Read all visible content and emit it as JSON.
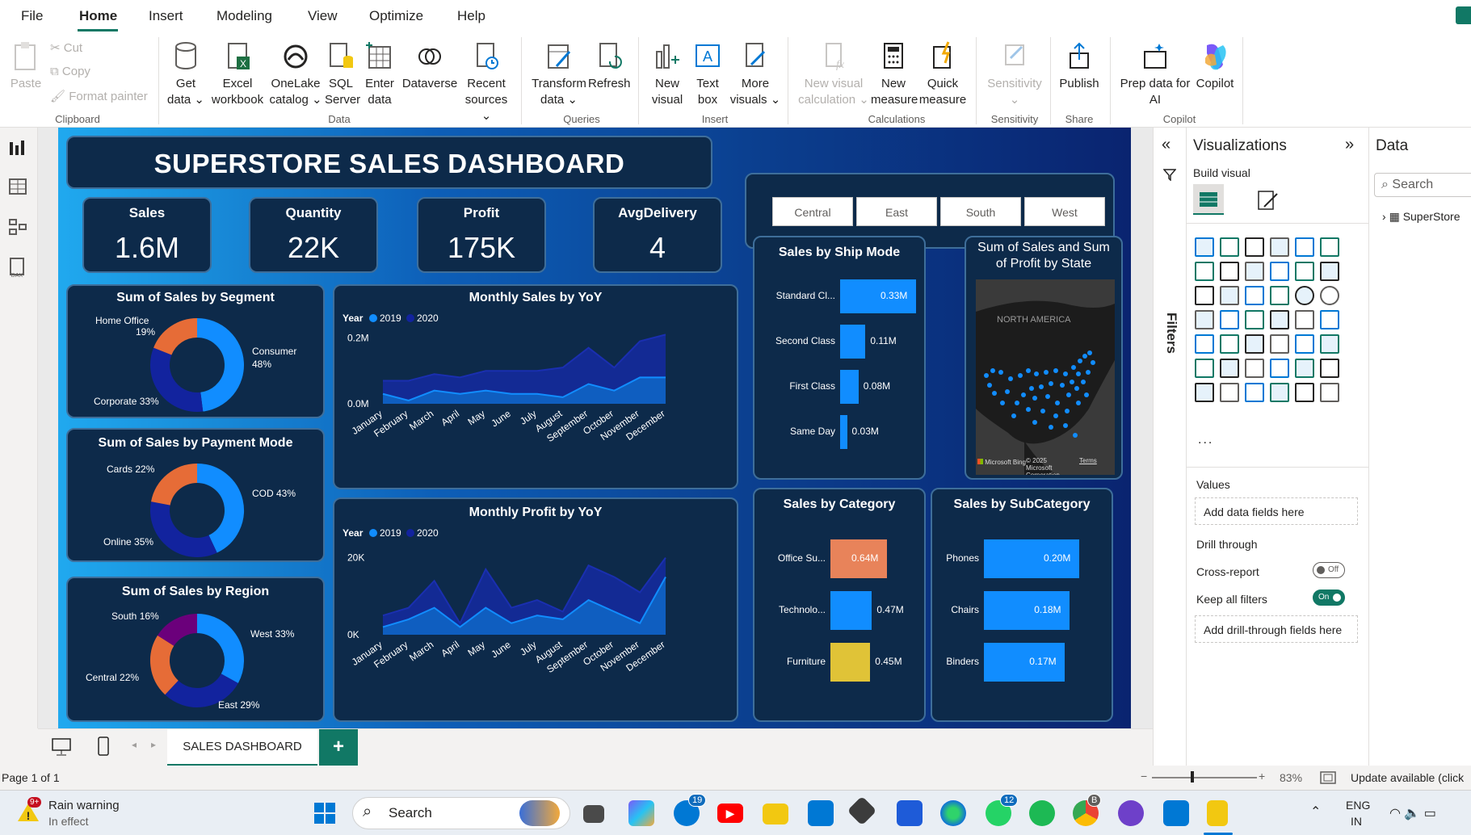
{
  "menu": {
    "file": "File",
    "home": "Home",
    "insert": "Insert",
    "modeling": "Modeling",
    "view": "View",
    "optimize": "Optimize",
    "help": "Help"
  },
  "ribbon": {
    "paste": "Paste",
    "cut": "Cut",
    "copy": "Copy",
    "format_painter": "Format painter",
    "clipboard": "Clipboard",
    "get_data_1": "Get",
    "get_data_2": "data",
    "excel_1": "Excel",
    "excel_2": "workbook",
    "onelake_1": "OneLake",
    "onelake_2": "catalog",
    "sql_1": "SQL",
    "sql_2": "Server",
    "enter_1": "Enter",
    "enter_2": "data",
    "dataverse": "Dataverse",
    "recent_1": "Recent",
    "recent_2": "sources",
    "data_group": "Data",
    "transform_1": "Transform",
    "transform_2": "data",
    "refresh": "Refresh",
    "queries": "Queries",
    "new_visual_1": "New",
    "new_visual_2": "visual",
    "text_box_1": "Text",
    "text_box_2": "box",
    "more_visuals_1": "More",
    "more_visuals_2": "visuals",
    "insert_group": "Insert",
    "new_visual_calc_1": "New visual",
    "new_visual_calc_2": "calculation",
    "new_measure_1": "New",
    "new_measure_2": "measure",
    "quick_measure_1": "Quick",
    "quick_measure_2": "measure",
    "calculations": "Calculations",
    "sensitivity": "Sensitivity",
    "sensitivity_group": "Sensitivity",
    "publish": "Publish",
    "share": "Share",
    "prep_1": "Prep data for",
    "prep_2": "AI",
    "copilot": "Copilot",
    "copilot_group": "Copilot"
  },
  "dashboard": {
    "title": "SUPERSTORE SALES DASHBOARD",
    "kpis": [
      {
        "label": "Sales",
        "value": "1.6M"
      },
      {
        "label": "Quantity",
        "value": "22K"
      },
      {
        "label": "Profit",
        "value": "175K"
      },
      {
        "label": "AvgDelivery",
        "value": "4"
      }
    ],
    "slicer": [
      "Central",
      "East",
      "South",
      "West"
    ],
    "segment": {
      "title": "Sum of Sales by Segment",
      "labels": [
        "Home Office",
        "19%",
        "Consumer",
        "48%",
        "Corporate 33%"
      ]
    },
    "payment": {
      "title": "Sum of Sales by Payment Mode",
      "labels": [
        "Cards 22%",
        "COD 43%",
        "Online 35%"
      ]
    },
    "region": {
      "title": "Sum of Sales by Region",
      "labels": [
        "South 16%",
        "West 33%",
        "Central 22%",
        "East 29%"
      ]
    },
    "monthly_sales": {
      "title": "Monthly Sales by YoY",
      "legend_title": "Year",
      "legend": [
        "2019",
        "2020"
      ],
      "yticks": [
        "0.2M",
        "0.0M"
      ]
    },
    "monthly_profit": {
      "title": "Monthly Profit by YoY",
      "legend_title": "Year",
      "legend": [
        "2019",
        "2020"
      ],
      "yticks": [
        "20K",
        "0K"
      ]
    },
    "months": [
      "January",
      "February",
      "March",
      "April",
      "May",
      "June",
      "July",
      "August",
      "September",
      "October",
      "November",
      "December"
    ],
    "ship_mode": {
      "title": "Sales by Ship Mode",
      "rows": [
        {
          "label": "Standard Cl...",
          "value": "0.33M"
        },
        {
          "label": "Second Class",
          "value": "0.11M"
        },
        {
          "label": "First Class",
          "value": "0.08M"
        },
        {
          "label": "Same Day",
          "value": "0.03M"
        }
      ]
    },
    "state_map": {
      "title_1": "Sum of Sales and Sum",
      "title_2": "of Profit by State",
      "region": "NORTH AMERICA",
      "credit": "© 2025 Microsoft Corporation",
      "terms": "Terms",
      "ms": "Microsoft Bing"
    },
    "category": {
      "title": "Sales by Category",
      "rows": [
        {
          "label": "Office Su...",
          "value": "0.64M"
        },
        {
          "label": "Technolo...",
          "value": "0.47M"
        },
        {
          "label": "Furniture",
          "value": "0.45M"
        }
      ]
    },
    "subcategory": {
      "title": "Sales by SubCategory",
      "rows": [
        {
          "label": "Phones",
          "value": "0.20M"
        },
        {
          "label": "Chairs",
          "value": "0.18M"
        },
        {
          "label": "Binders",
          "value": "0.17M"
        }
      ]
    }
  },
  "chart_data": [
    {
      "type": "pie",
      "title": "Sum of Sales by Segment",
      "categories": [
        "Consumer",
        "Corporate",
        "Home Office"
      ],
      "values": [
        48,
        33,
        19
      ]
    },
    {
      "type": "pie",
      "title": "Sum of Sales by Payment Mode",
      "categories": [
        "COD",
        "Online",
        "Cards"
      ],
      "values": [
        43,
        35,
        22
      ]
    },
    {
      "type": "pie",
      "title": "Sum of Sales by Region",
      "categories": [
        "West",
        "East",
        "Central",
        "South"
      ],
      "values": [
        33,
        29,
        22,
        16
      ]
    },
    {
      "type": "area",
      "title": "Monthly Sales by YoY",
      "categories": [
        "January",
        "February",
        "March",
        "April",
        "May",
        "June",
        "July",
        "August",
        "September",
        "October",
        "November",
        "December"
      ],
      "series": [
        {
          "name": "2019",
          "values": [
            0.03,
            0.01,
            0.04,
            0.03,
            0.04,
            0.03,
            0.03,
            0.02,
            0.06,
            0.04,
            0.08,
            0.08
          ]
        },
        {
          "name": "2020",
          "values": [
            0.07,
            0.07,
            0.09,
            0.08,
            0.1,
            0.1,
            0.1,
            0.11,
            0.17,
            0.11,
            0.19,
            0.21
          ]
        }
      ],
      "ylim": [
        0,
        0.26
      ]
    },
    {
      "type": "area",
      "title": "Monthly Profit by YoY",
      "categories": [
        "January",
        "February",
        "March",
        "April",
        "May",
        "June",
        "July",
        "August",
        "September",
        "October",
        "November",
        "December"
      ],
      "series": [
        {
          "name": "2019",
          "values": [
            2,
            4,
            7,
            2,
            7,
            3,
            5,
            4,
            9,
            6,
            3,
            15
          ]
        },
        {
          "name": "2020",
          "values": [
            5,
            7,
            14,
            3,
            17,
            7,
            9,
            6,
            18,
            15,
            11,
            20
          ]
        }
      ],
      "ylim": [
        0,
        26
      ]
    },
    {
      "type": "bar",
      "title": "Sales by Ship Mode",
      "categories": [
        "Standard Cl...",
        "Second Class",
        "First Class",
        "Same Day"
      ],
      "values": [
        0.33,
        0.11,
        0.08,
        0.03
      ]
    },
    {
      "type": "bar",
      "title": "Sales by Category",
      "categories": [
        "Office Su...",
        "Technolo...",
        "Furniture"
      ],
      "values": [
        0.64,
        0.47,
        0.45
      ]
    },
    {
      "type": "bar",
      "title": "Sales by SubCategory",
      "categories": [
        "Phones",
        "Chairs",
        "Binders"
      ],
      "values": [
        0.2,
        0.18,
        0.17
      ]
    }
  ],
  "colors": {
    "accent": "#117865",
    "consumer": "#118dff",
    "corporate": "#12239e",
    "home_office": "#e66c37",
    "south": "#6b007b",
    "bar": "#118dff",
    "office": "#e8835a",
    "furniture": "#e0c337"
  },
  "left_nav": [
    "report-view-icon",
    "table-view-icon",
    "model-view-icon",
    "dax-query-icon"
  ],
  "tabs": {
    "page": "SALES DASHBOARD",
    "add": "+"
  },
  "status": {
    "page": "Page 1 of 1",
    "zoom": "83%",
    "update": "Update available (click"
  },
  "filters_label": "Filters",
  "vis_panel": {
    "title": "Visualizations",
    "build": "Build visual",
    "values": "Values",
    "add_fields": "Add data fields here",
    "drill": "Drill through",
    "cross": "Cross-report",
    "cross_state": "Off",
    "keep": "Keep all filters",
    "keep_state": "On",
    "drill_fields": "Add drill-through fields here",
    "more": "..."
  },
  "data_panel": {
    "title": "Data",
    "search": "Search",
    "table": "SuperStore"
  },
  "taskbar": {
    "weather_badge": "9+",
    "weather_1": "Rain warning",
    "weather_2": "In effect",
    "search": "Search",
    "lang_1": "ENG",
    "lang_2": "IN",
    "badge_teams": "19",
    "badge_wa": "12",
    "badge_chrome": "B"
  }
}
